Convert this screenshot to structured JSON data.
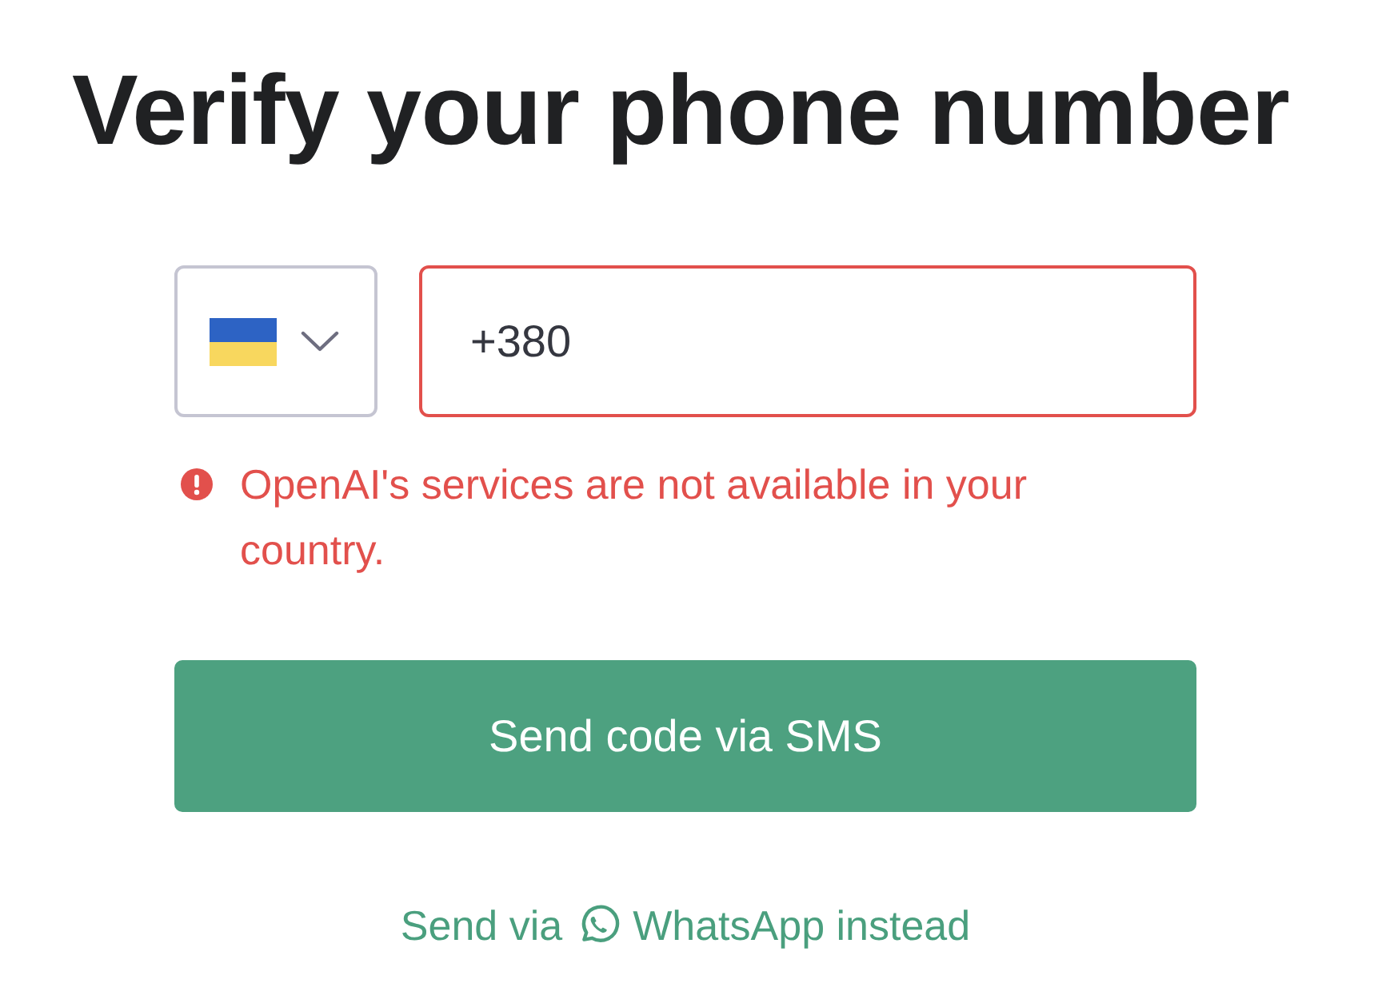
{
  "heading": "Verify your phone number",
  "phone_form": {
    "phone_field": {
      "value": "+380",
      "invalid": true
    },
    "error_message": "OpenAI's services are not available in your country.",
    "submit_button": "Send code via SMS",
    "whatsapp_link": {
      "text_before": "Send via",
      "text_after": "WhatsApp instead"
    }
  }
}
